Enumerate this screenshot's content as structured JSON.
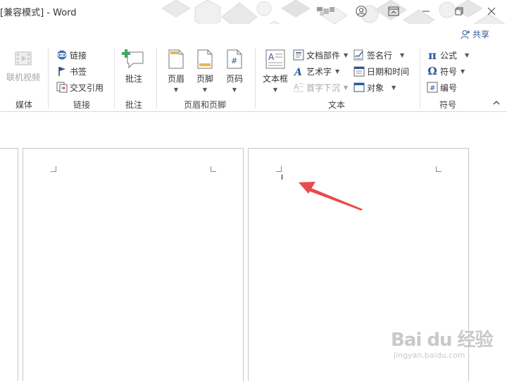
{
  "titlebar": {
    "title": "[兼容模式] - Word",
    "share_label": "共享"
  },
  "ribbon": {
    "groups": [
      {
        "label": "媒体",
        "buttons": [
          {
            "label": "联机视频",
            "icon": "video-icon",
            "disabled": true
          }
        ]
      },
      {
        "label": "链接",
        "buttons": [
          {
            "label": "链接",
            "icon": "link-icon"
          },
          {
            "label": "书签",
            "icon": "bookmark-flag-icon"
          },
          {
            "label": "交叉引用",
            "icon": "cross-reference-icon"
          }
        ]
      },
      {
        "label": "批注",
        "buttons": [
          {
            "label": "批注",
            "icon": "new-comment-icon"
          }
        ]
      },
      {
        "label": "页眉和页脚",
        "buttons": [
          {
            "label": "页眉",
            "icon": "header-icon"
          },
          {
            "label": "页脚",
            "icon": "footer-icon"
          },
          {
            "label": "页码",
            "icon": "page-number-icon"
          }
        ]
      },
      {
        "label": "文本",
        "buttons": [
          {
            "label": "文本框",
            "icon": "text-box-icon"
          },
          {
            "label": "文档部件",
            "icon": "quick-parts-icon"
          },
          {
            "label": "艺术字",
            "icon": "wordart-icon"
          },
          {
            "label": "首字下沉",
            "icon": "drop-cap-icon",
            "disabled": true
          },
          {
            "label": "签名行",
            "icon": "signature-line-icon"
          },
          {
            "label": "日期和时间",
            "icon": "date-time-icon"
          },
          {
            "label": "对象",
            "icon": "object-icon"
          }
        ]
      },
      {
        "label": "符号",
        "buttons": [
          {
            "label": "公式",
            "icon": "pi-equation-icon"
          },
          {
            "label": "符号",
            "icon": "omega-symbol-icon"
          },
          {
            "label": "编号",
            "icon": "number-icon"
          }
        ]
      }
    ]
  },
  "watermark": {
    "logo": "Bai du 经验",
    "url": "jingyan.baidu.com"
  },
  "colors": {
    "accent": "#2b579a",
    "arrow": "#e84b4b",
    "hex_pattern": "#e6e6e6"
  }
}
